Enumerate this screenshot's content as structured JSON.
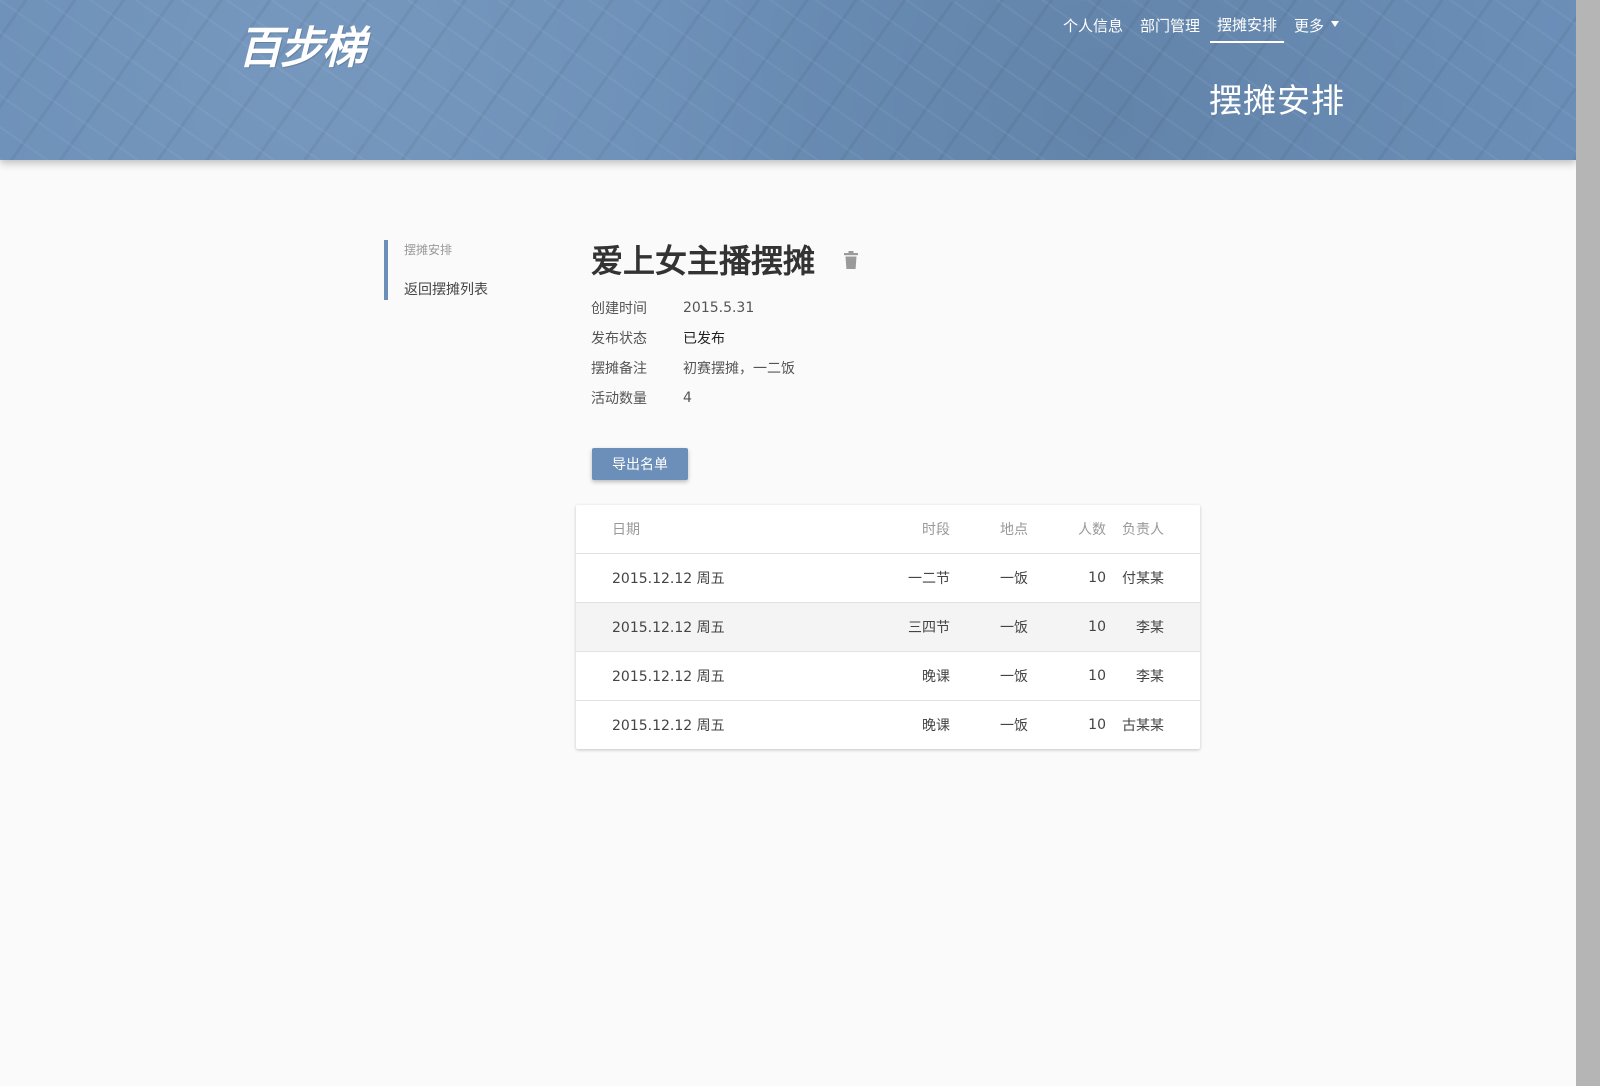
{
  "header": {
    "logo_text": "百步梯",
    "nav": [
      {
        "label": "个人信息",
        "active": false
      },
      {
        "label": "部门管理",
        "active": false
      },
      {
        "label": "摆摊安排",
        "active": true
      }
    ],
    "more_label": "更多",
    "page_heading": "摆摊安排",
    "accent_color": "#6b8fb8"
  },
  "sidebar": {
    "section_title": "摆摊安排",
    "back_link": "返回摆摊列表"
  },
  "main": {
    "title": "爱上女主播摆摊",
    "delete_icon": "trash-icon",
    "meta": [
      {
        "label": "创建时间",
        "value": "2015.5.31"
      },
      {
        "label": "发布状态",
        "value": "已发布"
      },
      {
        "label": "摆摊备注",
        "value": "初赛摆摊，一二饭"
      },
      {
        "label": "活动数量",
        "value": "4"
      }
    ],
    "export_button": "导出名单"
  },
  "table": {
    "headers": {
      "date": "日期",
      "slot": "时段",
      "place": "地点",
      "count": "人数",
      "owner": "负责人"
    },
    "rows": [
      {
        "date": "2015.12.12 周五",
        "slot": "一二节",
        "place": "一饭",
        "count": "10",
        "owner": "付某某"
      },
      {
        "date": "2015.12.12 周五",
        "slot": "三四节",
        "place": "一饭",
        "count": "10",
        "owner": "李某"
      },
      {
        "date": "2015.12.12 周五",
        "slot": "晚课",
        "place": "一饭",
        "count": "10",
        "owner": "李某"
      },
      {
        "date": "2015.12.12 周五",
        "slot": "晚课",
        "place": "一饭",
        "count": "10",
        "owner": "古某某"
      }
    ]
  }
}
